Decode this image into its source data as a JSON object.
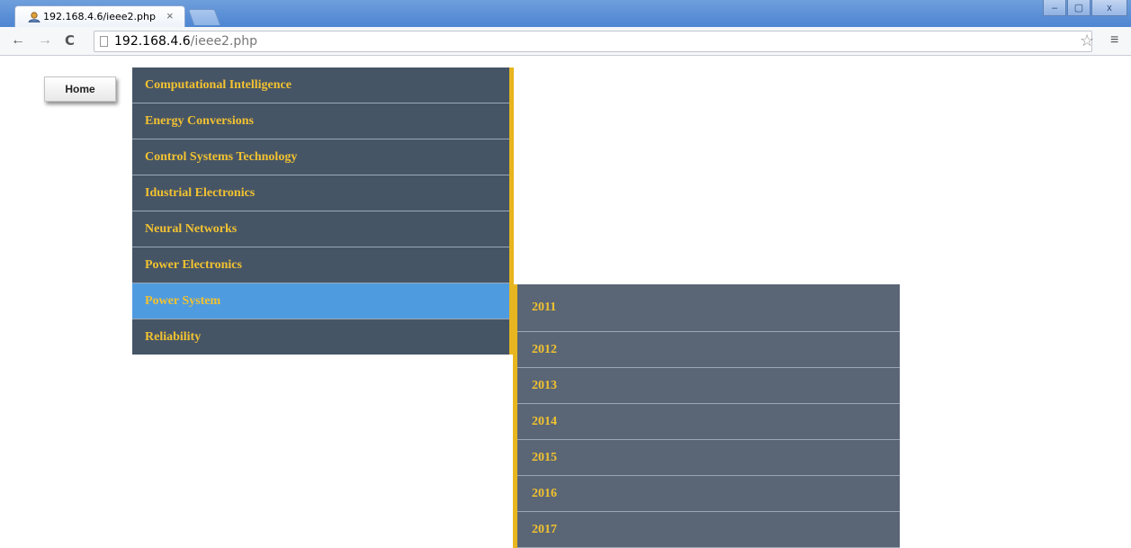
{
  "browser": {
    "tab_title": "192.168.4.6/ieee2.php",
    "tab_close": "×",
    "url_host": "192.168.4.6",
    "url_path": "/ieee2.php",
    "back_icon": "←",
    "forward_icon": "→",
    "reload_icon": "C",
    "star_icon": "☆",
    "menu_icon": "≡",
    "min_icon": "–",
    "max_icon": "▢",
    "close_icon": "x"
  },
  "page": {
    "home_label": "Home",
    "menu_items": [
      "Computational Intelligence",
      "Energy Conversions",
      "Control Systems Technology",
      "Idustrial Electronics",
      "Neural Networks",
      "Power Electronics",
      "Power System",
      "Reliability"
    ],
    "active_item": "Power System",
    "submenu_items": [
      "2011",
      "2012",
      "2013",
      "2014",
      "2015",
      "2016",
      "2017"
    ]
  },
  "colors": {
    "menu_bg": "#465566",
    "active_bg": "#4f9be0",
    "submenu_bg": "#5a6675",
    "accent": "#e7b51f",
    "text": "#f2c230"
  }
}
